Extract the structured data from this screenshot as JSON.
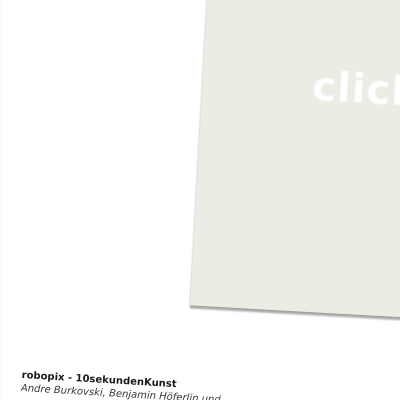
{
  "artwork": {
    "overlay_text": "click",
    "panel_color": "#ecebe4"
  },
  "caption": {
    "title": "robopix - 10sekundenKunst",
    "authors": "Andre Burkovski, Benjamin Höferlin und"
  }
}
